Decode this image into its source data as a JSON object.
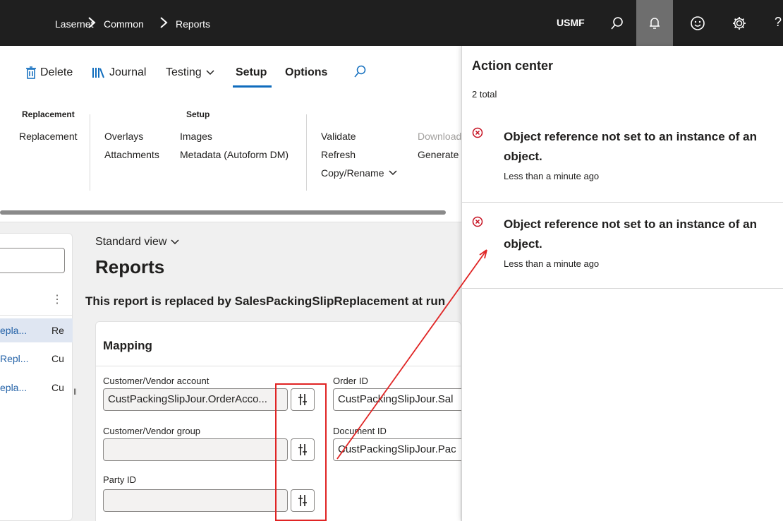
{
  "topbar": {
    "breadcrumb": [
      "Lasernet",
      "Common",
      "Reports"
    ],
    "company": "USMF",
    "icons": [
      "search-icon",
      "bell-icon",
      "smiley-icon",
      "gear-icon",
      "help-icon"
    ],
    "help_label": "?"
  },
  "ribbon": {
    "tabs": [
      {
        "label": "Delete",
        "icon": "trash-icon"
      },
      {
        "label": "Journal",
        "icon": "books-icon"
      },
      {
        "label": "Testing",
        "icon": "chevron-down-icon"
      },
      {
        "label": "Setup",
        "selected": true
      },
      {
        "label": "Options"
      }
    ],
    "groups": {
      "replacement_header": "Replacement",
      "setup_header": "Setup",
      "replacement": "Replacement",
      "overlays": "Overlays",
      "attachments": "Attachments",
      "images": "Images",
      "metadata": "Metadata (Autoform DM)",
      "validate": "Validate",
      "refresh": "Refresh",
      "copy_rename": "Copy/Rename",
      "download": "Download",
      "generate": "Generate"
    }
  },
  "leftpanel": {
    "more_label": "⋮",
    "rows": [
      {
        "c1": "epla...",
        "c2": "Re",
        "selected": true
      },
      {
        "c1": "Repl...",
        "c2": "Cu",
        "selected": false
      },
      {
        "c1": "epla...",
        "c2": "Cu",
        "selected": false
      }
    ]
  },
  "main": {
    "view_selector": "Standard view",
    "title": "Reports",
    "banner": "This report is replaced by SalesPackingSlipReplacement at run",
    "mapping": {
      "title": "Mapping",
      "customer_vendor_account_label": "Customer/Vendor account",
      "customer_vendor_account_value": "CustPackingSlipJour.OrderAcco...",
      "customer_vendor_group_label": "Customer/Vendor group",
      "customer_vendor_group_value": "",
      "party_id_label": "Party ID",
      "party_id_value": "",
      "order_id_label": "Order ID",
      "order_id_value": "CustPackingSlipJour.Sal",
      "document_id_label": "Document ID",
      "document_id_value": "CustPackingSlipJour.Pac"
    }
  },
  "action_center": {
    "title": "Action center",
    "total": "2 total",
    "items": [
      {
        "message": "Object reference not set to an instance of an object.",
        "time": "Less than a minute ago"
      },
      {
        "message": "Object reference not set to an instance of an object.",
        "time": "Less than a minute ago"
      }
    ]
  },
  "colors": {
    "nav_bg": "#1f1f1f",
    "accent": "#0f6cbd",
    "error": "#c50f1f",
    "annotation": "#e02424"
  }
}
